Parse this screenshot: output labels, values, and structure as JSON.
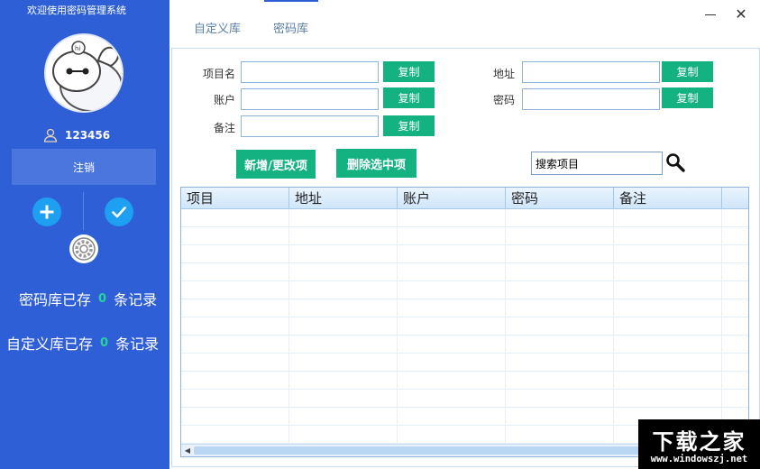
{
  "sidebar": {
    "app_title": "欢迎使用密码管理系统",
    "username": "123456",
    "logout_label": "注销",
    "count_pwd": {
      "prefix": "密码库已存",
      "value": "0",
      "suffix": "条记录"
    },
    "count_custom": {
      "prefix": "自定义库已存",
      "value": "0",
      "suffix": "条记录"
    }
  },
  "tabs": [
    {
      "label": "自定义库",
      "active": false
    },
    {
      "label": "密码库",
      "active": true
    }
  ],
  "window_controls": {
    "close_label": "✕"
  },
  "form": {
    "item_label": "项目名",
    "item_value": "",
    "account_label": "账户",
    "account_value": "",
    "note_label": "备注",
    "note_value": "",
    "address_label": "地址",
    "address_value": "",
    "password_label": "密码",
    "password_value": "",
    "copy_label": "复制"
  },
  "actions": {
    "add_update_label": "新增/更改项",
    "delete_label": "删除选中项",
    "search_value": "搜索项目"
  },
  "table": {
    "columns": [
      "项目",
      "地址",
      "账户",
      "密码",
      "备注"
    ]
  },
  "watermark": {
    "title": "下载之家",
    "url": "www.windowszj.net"
  },
  "colors": {
    "sidebar_bg": "#2f5fd6",
    "accent_green": "#14b281",
    "round_button_blue": "#1e9ff2",
    "count_number": "#27d49a"
  }
}
